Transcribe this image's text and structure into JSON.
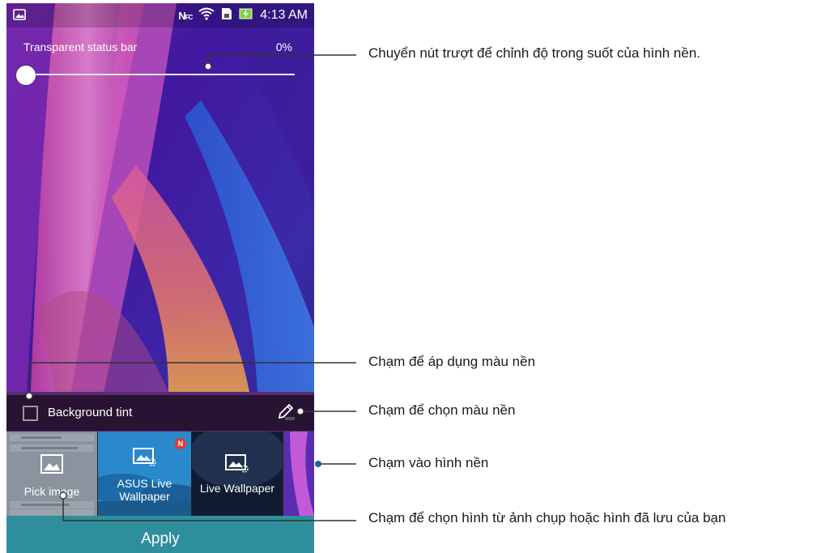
{
  "status_bar": {
    "nfc_label": "N",
    "nfc_sub": "FC",
    "time": "4:13 AM"
  },
  "slider": {
    "label": "Transparent status bar",
    "value_text": "0%",
    "value": 0
  },
  "background_tint": {
    "label": "Background tint",
    "checked": false
  },
  "thumbnails": {
    "pick_image": "Pick image",
    "asus_live_line1": "ASUS Live",
    "asus_live_line2": "Wallpaper",
    "asus_badge": "N",
    "live_wallpaper": "Live Wallpaper"
  },
  "apply_label": "Apply",
  "callouts": {
    "slider": "Chuyển nút trượt để chỉnh độ trong suốt của hình nền.",
    "tint_checkbox": "Chạm để áp dụng màu nền",
    "tint_color": "Chạm để chọn màu nền",
    "wallpaper": "Chạm vào hình nền",
    "pick_image": "Chạm để chọn hình từ ảnh chụp hoặc hình đã lưu của bạn"
  },
  "colors": {
    "apply": "#2f8e9c",
    "accent_purple": "#4a1c88"
  }
}
